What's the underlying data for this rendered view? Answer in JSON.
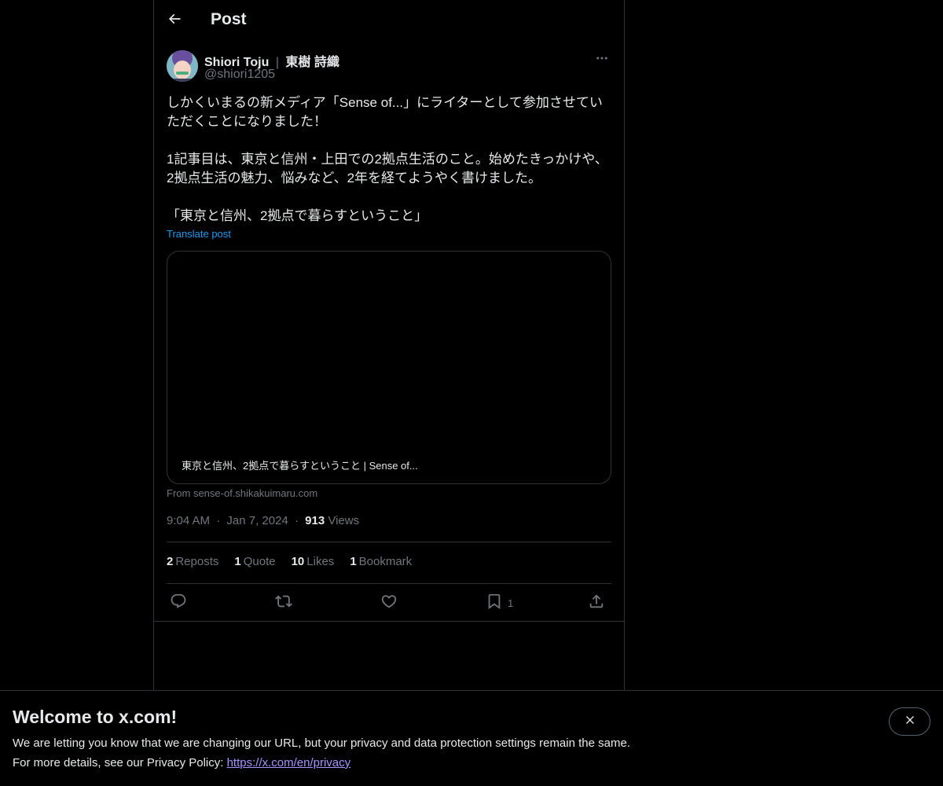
{
  "header": {
    "title": "Post",
    "back_icon": "arrow-left-icon"
  },
  "author": {
    "name": "Shiori Toju",
    "name_ja": "東樹 詩織",
    "handle": "@shiori1205"
  },
  "post": {
    "line1": "しかくいまるの新メディア「Sense of...」にライターとして参加させてい",
    "line2": "ただくことになりました！",
    "line3": "1記事目は、東京と信州・上田での2拠点生活のこと。始めたきっかけや、",
    "line4": "2拠点生活の魅力、悩みなど、2年を経てようやく書けました。",
    "line5": "「東京と信州、2拠点で暮らすということ」",
    "translate": "Translate post"
  },
  "card": {
    "title": "東京と信州、2拠点で暮らすということ | Sense of...",
    "source": "From sense-of.shikakuimaru.com"
  },
  "meta": {
    "time": "9:04 AM",
    "date": "Jan 7, 2024",
    "views_count": "913",
    "views_label": "Views"
  },
  "stats": {
    "reposts_count": "2",
    "reposts_label": "Reposts",
    "quotes_count": "1",
    "quotes_label": "Quote",
    "likes_count": "10",
    "likes_label": "Likes",
    "bookmarks_count": "1",
    "bookmarks_label": "Bookmark"
  },
  "actions": {
    "bookmark_count": "1"
  },
  "banner": {
    "title": "Welcome to x.com!",
    "line1": "We are letting you know that we are changing our URL, but your privacy and data protection settings remain the same.",
    "line2_prefix": "For more details, see our Privacy Policy: ",
    "link": "https://x.com/en/privacy"
  },
  "colors": {
    "background": "#000000",
    "text": "#e7e9ea",
    "muted": "#71767b",
    "accent": "#1d9bf0",
    "border": "#2f3336",
    "link": "#a894ff"
  }
}
